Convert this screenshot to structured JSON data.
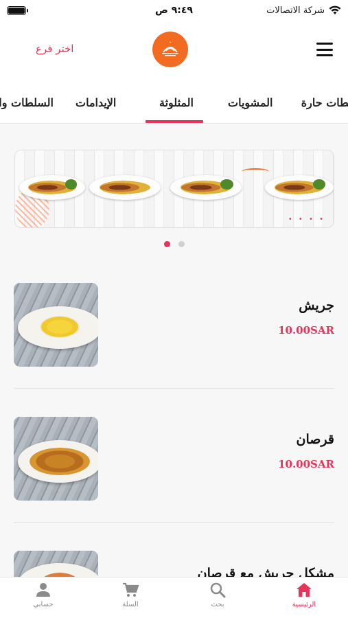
{
  "status_bar": {
    "time": "٩:٤٩ ص",
    "carrier": "شركة الاتصالات"
  },
  "header": {
    "branch_link": "اختر فرع",
    "logo_icon": "restaurant-logo-icon",
    "menu_icon": "hamburger-menu-icon"
  },
  "tabs": [
    {
      "label": "سلطات حارة"
    },
    {
      "label": "المشويات"
    },
    {
      "label": "المثلوثة",
      "active": true
    },
    {
      "label": "الإيدامات"
    },
    {
      "label": "السلطات والمقبلات"
    }
  ],
  "banner": {
    "slides": 2,
    "active_slide": 1
  },
  "products": [
    {
      "name": "جريش",
      "price": "10.00SAR"
    },
    {
      "name": "قرصان",
      "price": "10.00SAR"
    },
    {
      "name": "مشكل جريش مع قرصان",
      "price": ""
    }
  ],
  "tabbar": {
    "items": [
      {
        "label": "الرئيسية",
        "icon": "home-icon",
        "active": true
      },
      {
        "label": "بحث",
        "icon": "search-icon"
      },
      {
        "label": "السلة",
        "icon": "cart-icon"
      },
      {
        "label": "حسابي",
        "icon": "person-icon"
      }
    ]
  },
  "colors": {
    "accent": "#e8335a",
    "logo": "#f26b21"
  }
}
